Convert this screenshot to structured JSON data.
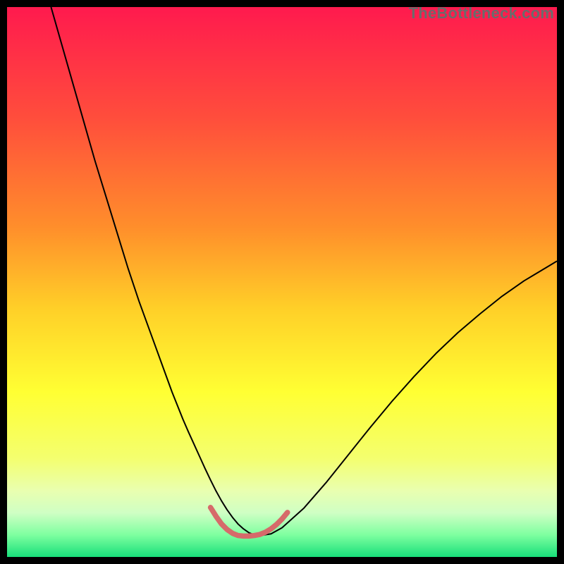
{
  "watermark": "TheBottleneck.com",
  "chart_data": {
    "type": "line",
    "title": "",
    "xlabel": "",
    "ylabel": "",
    "xlim": [
      0,
      100
    ],
    "ylim": [
      0,
      100
    ],
    "grid": false,
    "legend": false,
    "background_gradient": {
      "stops": [
        {
          "pos": 0.0,
          "color": "#ff1a4e"
        },
        {
          "pos": 0.2,
          "color": "#ff4d3c"
        },
        {
          "pos": 0.4,
          "color": "#ff8e2b"
        },
        {
          "pos": 0.55,
          "color": "#ffd028"
        },
        {
          "pos": 0.7,
          "color": "#ffff33"
        },
        {
          "pos": 0.82,
          "color": "#f4ff6e"
        },
        {
          "pos": 0.88,
          "color": "#e9ffb0"
        },
        {
          "pos": 0.92,
          "color": "#cfffc4"
        },
        {
          "pos": 0.96,
          "color": "#7effa0"
        },
        {
          "pos": 1.0,
          "color": "#18e07a"
        }
      ]
    },
    "series": [
      {
        "name": "bottleneck-curve",
        "stroke": "#000000",
        "stroke_width": 2.0,
        "x": [
          8,
          10,
          12,
          14,
          16,
          18,
          20,
          22,
          24,
          26,
          28,
          30,
          32,
          33,
          34,
          35,
          36,
          37,
          38,
          39,
          40,
          41,
          42,
          43,
          44,
          45,
          46,
          48,
          50,
          54,
          58,
          62,
          66,
          70,
          74,
          78,
          82,
          86,
          90,
          94,
          98,
          100
        ],
        "y": [
          100,
          93,
          86,
          79,
          72,
          65.5,
          59,
          52.5,
          46.5,
          41,
          35.5,
          30,
          25,
          22.7,
          20.5,
          18.3,
          16.1,
          14,
          12,
          10.2,
          8.6,
          7.2,
          6.0,
          5.1,
          4.4,
          4.0,
          3.9,
          4.2,
          5.3,
          8.9,
          13.5,
          18.5,
          23.5,
          28.3,
          32.8,
          37,
          40.8,
          44.2,
          47.4,
          50.2,
          52.6,
          53.8
        ]
      },
      {
        "name": "sweet-spot-overlay",
        "stroke": "#d66a6a",
        "stroke_width": 7.5,
        "linecap": "round",
        "x": [
          37,
          38,
          39,
          40,
          41,
          42,
          43,
          44,
          45,
          46,
          47,
          48,
          49,
          50,
          51
        ],
        "y": [
          9.0,
          7.4,
          6.0,
          5.0,
          4.3,
          3.9,
          3.8,
          3.8,
          3.9,
          4.1,
          4.5,
          5.1,
          5.9,
          6.9,
          8.1
        ]
      }
    ],
    "annotations": []
  }
}
